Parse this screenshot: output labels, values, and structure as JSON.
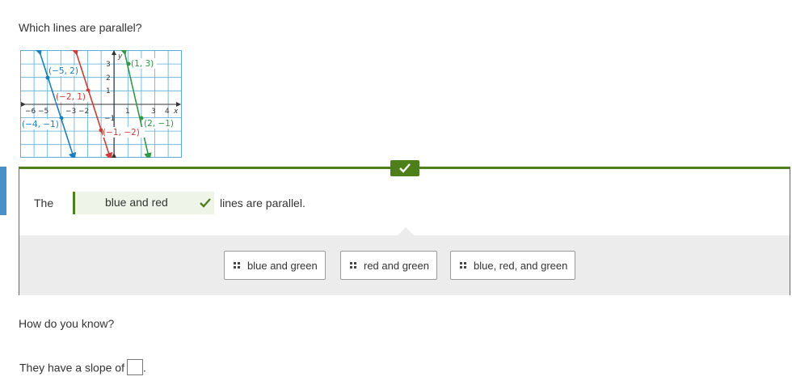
{
  "question": "Which lines are parallel?",
  "graph": {
    "x_tick_labels": [
      "−6",
      "−5",
      "−3",
      "−2",
      "1",
      "3",
      "4"
    ],
    "y_tick_labels": [
      "3",
      "2",
      "1",
      "−1"
    ],
    "x_axis_label": "x",
    "y_axis_label": "y",
    "points": {
      "blue_1": "(−5, 2)",
      "blue_2": "(−4, −1)",
      "red_1": "(−2, 1)",
      "red_2": "(−1, −2)",
      "green_1": "(1, 3)",
      "green_2": "(2, −1)"
    },
    "colors": {
      "blue": "#1a7fc1",
      "red": "#d43a32",
      "green": "#2e9a46",
      "grid": "#5aaed6"
    }
  },
  "answer": {
    "prefix": "The",
    "selected": "blue and red",
    "suffix": "lines are parallel.",
    "correct_color": "#4d7f1a"
  },
  "choices": [
    "blue and green",
    "red and green",
    "blue, red, and green"
  ],
  "followup": "How do you know?",
  "slope": {
    "prefix": "They have a slope of",
    "value": "",
    "suffix": "."
  }
}
